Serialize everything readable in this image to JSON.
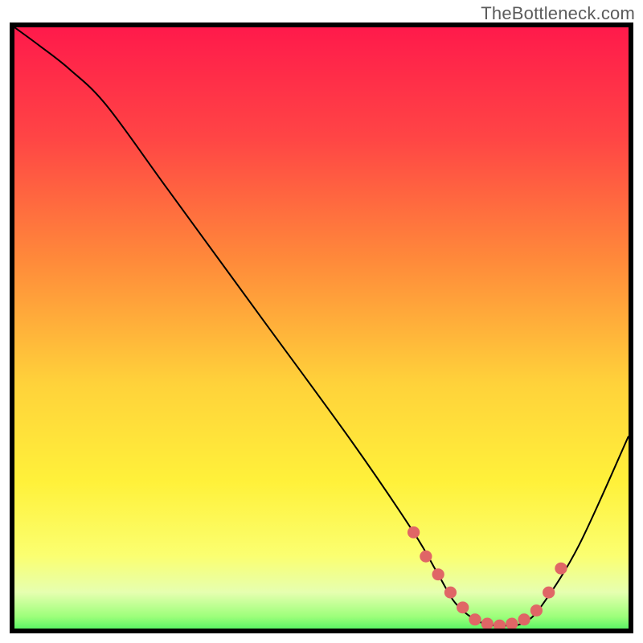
{
  "watermark": "TheBottleneck.com",
  "chart_data": {
    "type": "line",
    "title": "",
    "xlabel": "",
    "ylabel": "",
    "xlim": [
      0,
      100
    ],
    "ylim": [
      0,
      100
    ],
    "gradient_stops": [
      {
        "offset": 0,
        "color": "#ff1a4b"
      },
      {
        "offset": 18,
        "color": "#ff4545"
      },
      {
        "offset": 38,
        "color": "#ff8a3a"
      },
      {
        "offset": 58,
        "color": "#ffd23a"
      },
      {
        "offset": 74,
        "color": "#fff13a"
      },
      {
        "offset": 86,
        "color": "#fbff70"
      },
      {
        "offset": 92,
        "color": "#e6ffb0"
      },
      {
        "offset": 96,
        "color": "#9cff7a"
      },
      {
        "offset": 100,
        "color": "#17e84e"
      }
    ],
    "series": [
      {
        "name": "bottleneck-curve",
        "x": [
          0,
          4,
          9,
          15,
          25,
          40,
          55,
          65,
          69,
          72,
          76,
          80,
          83,
          86,
          92,
          100
        ],
        "y": [
          100,
          97,
          93,
          87,
          73,
          52,
          31,
          16,
          9,
          4,
          1,
          0.5,
          1,
          4,
          14,
          32
        ]
      }
    ],
    "highlight_dots": {
      "name": "optimal-range",
      "x": [
        65,
        67,
        69,
        71,
        73,
        75,
        77,
        79,
        81,
        83,
        85,
        87,
        89
      ],
      "y": [
        16,
        12,
        9,
        6,
        3.5,
        1.5,
        0.8,
        0.5,
        0.8,
        1.5,
        3,
        6,
        10
      ]
    }
  }
}
